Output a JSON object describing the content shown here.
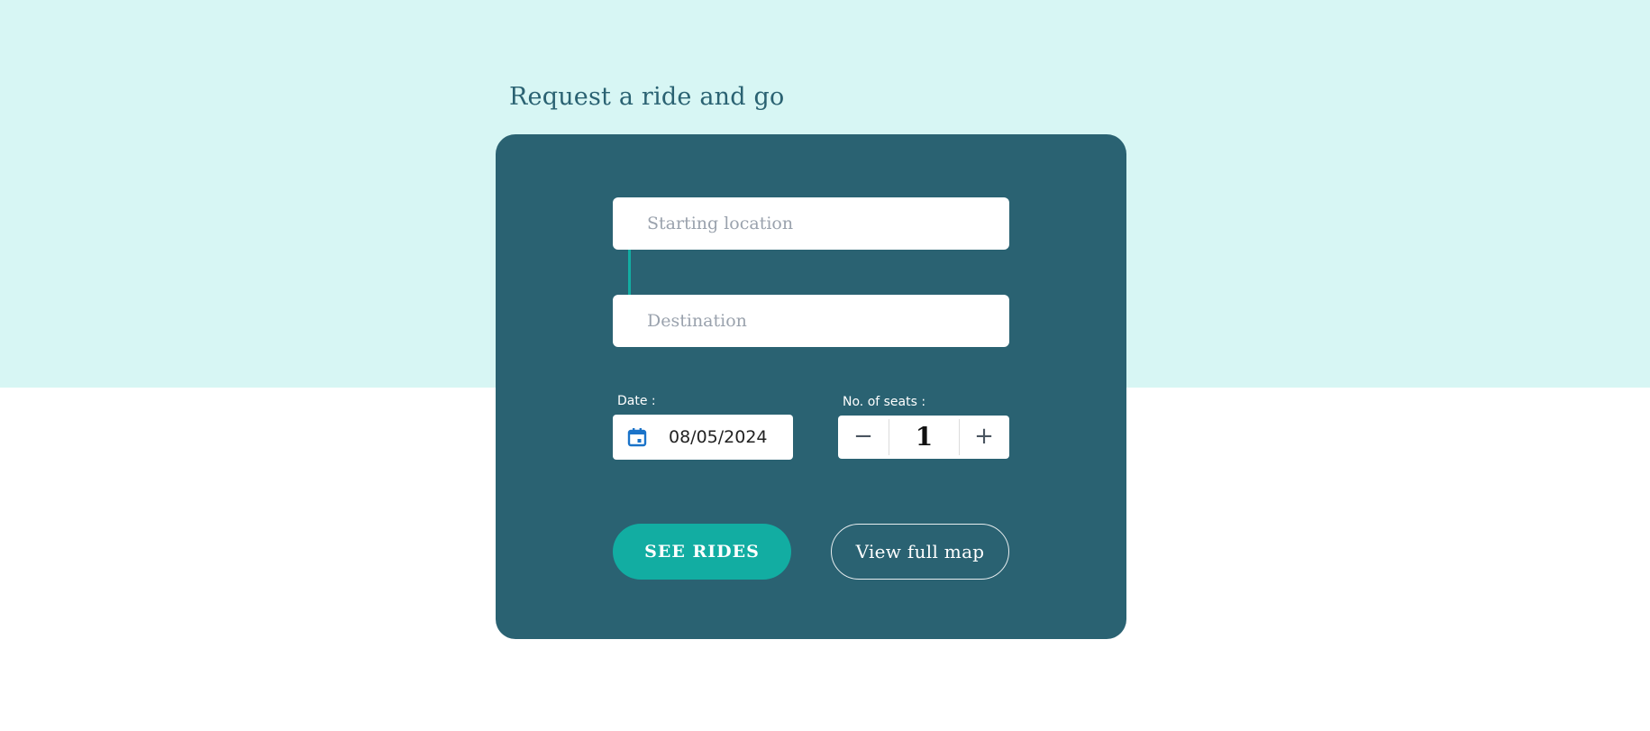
{
  "page": {
    "title": "Request a ride and go"
  },
  "form": {
    "start_placeholder": "Starting location",
    "start_value": "",
    "destination_placeholder": "Destination",
    "destination_value": "",
    "date_label": "Date :",
    "date_value": "08/05/2024",
    "date_icon": "calendar-icon",
    "seats_label": "No. of seats :",
    "seats_value": "1",
    "minus_symbol": "−",
    "plus_symbol": "+",
    "see_rides_label": "SEE RIDES",
    "view_map_label": "View full map"
  },
  "colors": {
    "top_band": "#d7f6f4",
    "card": "#2a6272",
    "accent": "#12ada2",
    "title": "#2a6272",
    "calendar_icon": "#1a73c9"
  }
}
